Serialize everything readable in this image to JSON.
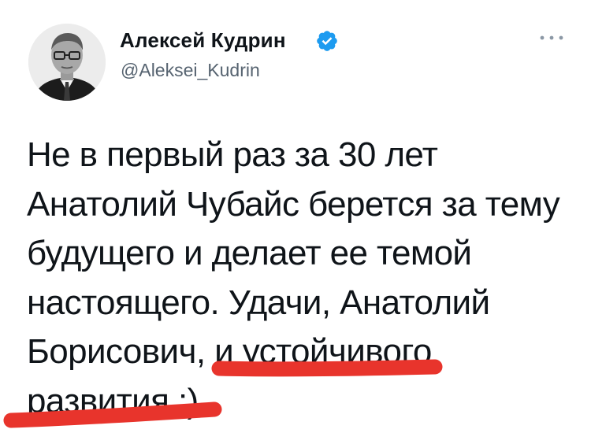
{
  "author": {
    "name": "Алексей Кудрин",
    "handle": "@Aleksei_Kudrin",
    "verified_icon": "verified-badge-icon",
    "avatar_icon": "profile-photo"
  },
  "menu_icon": "more-horizontal-icon",
  "tweet": {
    "lines": [
      "Не в первый раз за 30 лет",
      "Анатолий Чубайс берется за тему",
      "будущего и делает ее темой",
      "настоящего. Удачи, Анатолий",
      "Борисович, и устойчивого",
      "развития :)"
    ]
  },
  "colors": {
    "text": "#0f1419",
    "handle": "#566370",
    "verified": "#1d9bf0",
    "highlight_marker": "#e8342c"
  }
}
